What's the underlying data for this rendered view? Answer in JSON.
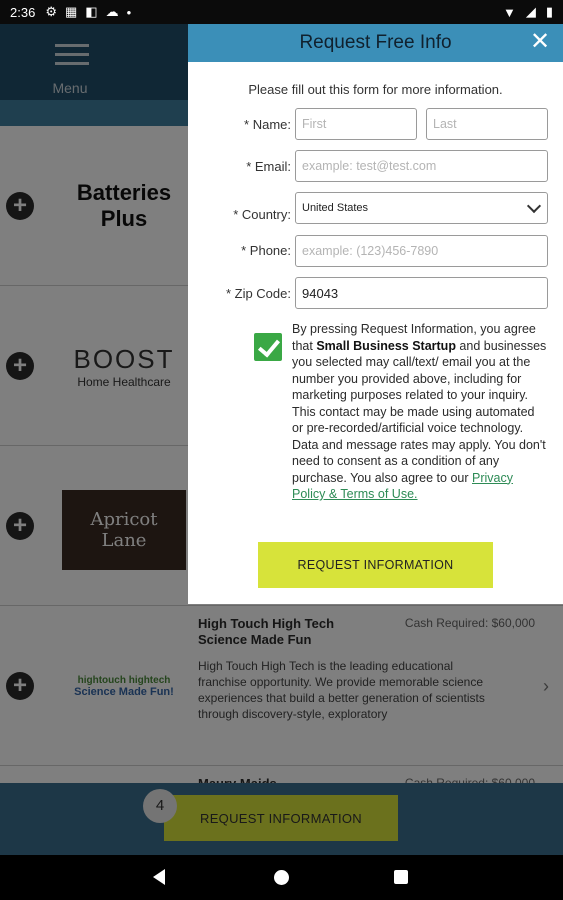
{
  "status_bar": {
    "time": "2:36"
  },
  "app": {
    "menu_label": "Menu",
    "list": [
      {
        "logo": "Batteries Plus",
        "logo_line1": "Batteries",
        "logo_line2": "Plus"
      },
      {
        "logo": "BOOST Home Healthcare",
        "logo_line1": "BOOST",
        "logo_line2": "Home Healthcare"
      },
      {
        "logo": "Apricot Lane",
        "logo_line1": "Apricot",
        "logo_line2": "Lane"
      },
      {
        "title": "High Touch High Tech Science Made Fun",
        "cash": "Cash Required: $60,000",
        "description": "High Touch High Tech is the leading educational franchise opportunity. We provide memorable science experiences that build a better generation of scientists through discovery-style, exploratory",
        "logo_line1": "hightouch hightech",
        "logo_line2": "Science Made Fun!"
      },
      {
        "title": "Maury Maids",
        "cash": "Cash Required: $60,000"
      }
    ],
    "bottom": {
      "count": "4",
      "button": "REQUEST INFORMATION"
    }
  },
  "modal": {
    "title": "Request Free Info",
    "intro": "Please fill out this form for more information.",
    "fields": {
      "name_label": "* Name:",
      "first_placeholder": "First",
      "last_placeholder": "Last",
      "email_label": "* Email:",
      "email_placeholder": "example: test@test.com",
      "country_label": "* Country:",
      "country_value": "United States",
      "phone_label": "* Phone:",
      "phone_placeholder": "example: (123)456-7890",
      "zip_label": "* Zip Code:",
      "zip_value": "94043"
    },
    "consent": {
      "checked": true,
      "text_before": "By pressing Request Information, you agree that ",
      "company": "Small Business Startup",
      "text_after": " and businesses you selected may call/text/ email you at the number you provided above, including for marketing purposes related to your inquiry. This contact may be made using automated or pre-recorded/artificial voice technology. Data and message rates may apply. You don't need to consent as a condition of any purchase. You also agree to our ",
      "link": "Privacy Policy & Terms of Use."
    },
    "submit": "REQUEST INFORMATION"
  },
  "colors": {
    "header": "#3b8fb8",
    "accent_button": "#d7e33a",
    "checkbox": "#3aa845",
    "link": "#2d8b55"
  }
}
